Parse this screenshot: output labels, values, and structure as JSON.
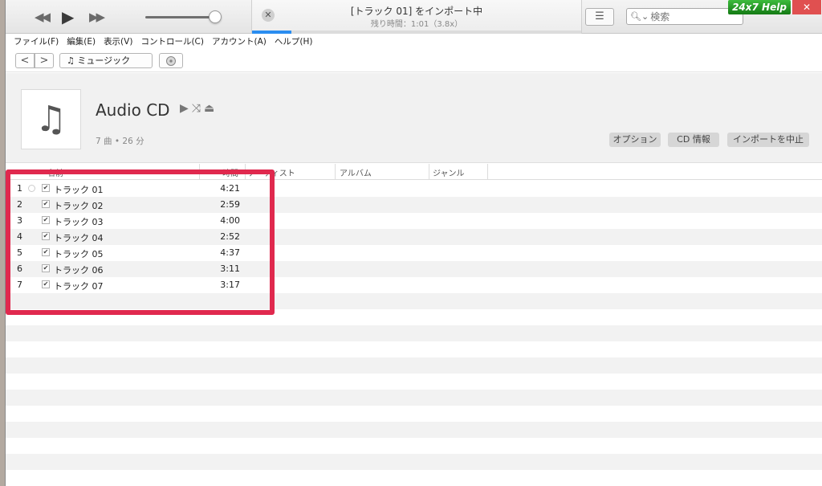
{
  "player": {
    "prev_icon": "rewind-icon",
    "play_icon": "play-icon",
    "next_icon": "fast-forward-icon",
    "volume": 0.9
  },
  "lcd": {
    "title": "[トラック 01] をインポート中",
    "subtitle": "残り時間：1:01（3.8x）",
    "progress": 0.12
  },
  "search": {
    "placeholder": "検索"
  },
  "help_badge": "24x7 Help",
  "window_close": "✕",
  "menu": [
    "ファイル(F)",
    "編集(E)",
    "表示(V)",
    "コントロール(C)",
    "アカウント(A)",
    "ヘルプ(H)"
  ],
  "nav": {
    "back": "<",
    "forward": ">",
    "media_kind": "ミュージック"
  },
  "album": {
    "title": "Audio CD",
    "meta": "7 曲 • 26 分",
    "options_label": "オプション",
    "cd_info_label": "CD 情報",
    "stop_import_label": "インポートを中止"
  },
  "columns": {
    "name": "名前",
    "time": "時間",
    "artist": "アーティスト",
    "album": "アルバム",
    "genre": "ジャンル"
  },
  "tracks": [
    {
      "num": "1",
      "name": "トラック 01",
      "time": "4:21"
    },
    {
      "num": "2",
      "name": "トラック 02",
      "time": "2:59"
    },
    {
      "num": "3",
      "name": "トラック 03",
      "time": "4:00"
    },
    {
      "num": "4",
      "name": "トラック 04",
      "time": "2:52"
    },
    {
      "num": "5",
      "name": "トラック 05",
      "time": "4:37"
    },
    {
      "num": "6",
      "name": "トラック 06",
      "time": "3:11"
    },
    {
      "num": "7",
      "name": "トラック 07",
      "time": "3:17"
    }
  ],
  "colors": {
    "accent": "#2a8df0",
    "highlight": "#e0294e",
    "help": "#1f9a1f"
  }
}
